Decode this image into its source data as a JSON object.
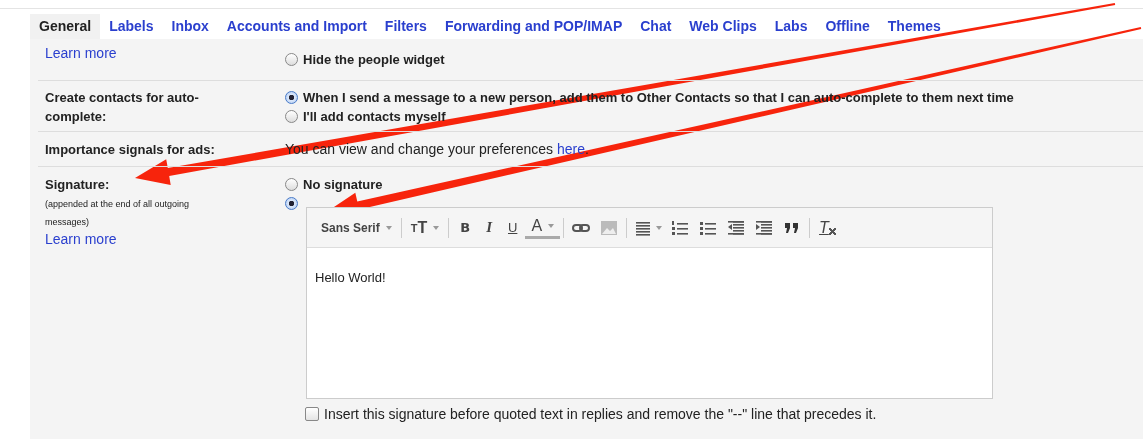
{
  "tabs": [
    {
      "label": "General",
      "selected": true
    },
    {
      "label": "Labels",
      "selected": false
    },
    {
      "label": "Inbox",
      "selected": false
    },
    {
      "label": "Accounts and Import",
      "selected": false
    },
    {
      "label": "Filters",
      "selected": false
    },
    {
      "label": "Forwarding and POP/IMAP",
      "selected": false
    },
    {
      "label": "Chat",
      "selected": false
    },
    {
      "label": "Web Clips",
      "selected": false
    },
    {
      "label": "Labs",
      "selected": false
    },
    {
      "label": "Offline",
      "selected": false
    },
    {
      "label": "Themes",
      "selected": false
    }
  ],
  "settings": [
    {
      "kind": "radios",
      "link": "Learn more",
      "options": [
        {
          "label": "Hide the people widget",
          "selected": false
        }
      ]
    },
    {
      "kind": "radios",
      "label": "Create contacts for auto-complete:",
      "options": [
        {
          "label": "When I send a message to a new person, add them to Other Contacts so that I can auto-complete to them next time",
          "selected": true
        },
        {
          "label": "I'll add contacts myself",
          "selected": false
        }
      ]
    },
    {
      "kind": "text",
      "label": "Importance signals for ads:",
      "text": "You can view and change your preferences",
      "link_text": "here",
      "after": "."
    },
    {
      "kind": "signature",
      "label": "Signature:",
      "note": "(appended at the end of all outgoing messages)",
      "link": "Learn more",
      "options": [
        {
          "label": "No signature",
          "selected": false
        },
        {
          "selected": true
        }
      ],
      "toolbar": [
        {
          "kind": "font",
          "label": "Sans Serif"
        },
        {
          "kind": "sep"
        },
        {
          "kind": "size",
          "label": "TT"
        },
        {
          "kind": "sep"
        },
        {
          "kind": "bold",
          "label": "B"
        },
        {
          "kind": "italic",
          "label": "I"
        },
        {
          "kind": "underline",
          "label": "U"
        },
        {
          "kind": "color",
          "label": "A"
        },
        {
          "kind": "sep"
        },
        {
          "kind": "link"
        },
        {
          "kind": "image"
        },
        {
          "kind": "sep"
        },
        {
          "kind": "align"
        },
        {
          "kind": "numbered"
        },
        {
          "kind": "bulleted"
        },
        {
          "kind": "outdent"
        },
        {
          "kind": "indent"
        },
        {
          "kind": "quote"
        },
        {
          "kind": "sep"
        },
        {
          "kind": "clear",
          "label": "T"
        }
      ],
      "body": "Hello World!",
      "checkbox": {
        "label": "Insert this signature before quoted text in replies and remove the \"--\" line that precedes it.",
        "checked": false
      }
    }
  ],
  "annotations": [
    {
      "kind": "arrow"
    },
    {
      "kind": "arrow"
    }
  ]
}
